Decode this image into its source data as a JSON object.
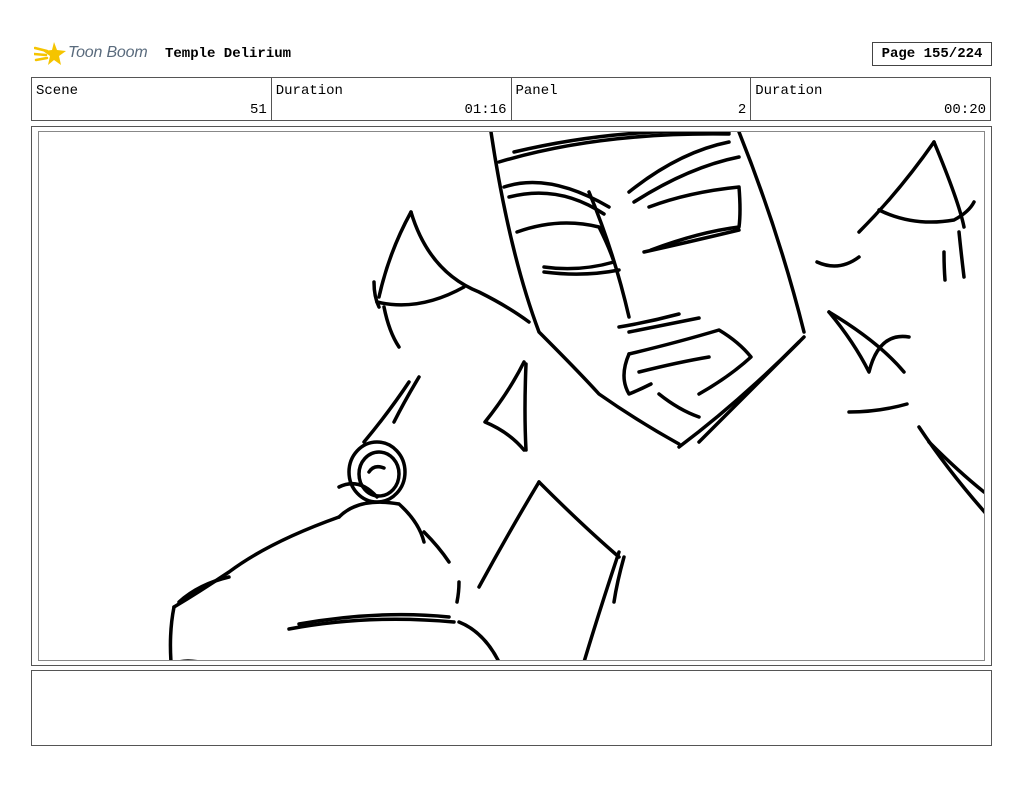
{
  "header": {
    "logo_text": "Toon Boom",
    "project_title": "Temple Delirium",
    "page_label": "Page 155/224"
  },
  "info_bar": {
    "cells": [
      {
        "label": "Scene",
        "value": "51"
      },
      {
        "label": "Duration",
        "value": "01:16"
      },
      {
        "label": "Panel",
        "value": "2"
      },
      {
        "label": "Duration",
        "value": "00:20"
      }
    ]
  },
  "panel": {
    "image": "rough-sketch-face-and-hand"
  },
  "notes": {
    "text": ""
  },
  "colors": {
    "logo_star": "#f5c400",
    "logo_text": "#5a6b7d",
    "border": "#555555",
    "sketch_stroke": "#000000"
  }
}
